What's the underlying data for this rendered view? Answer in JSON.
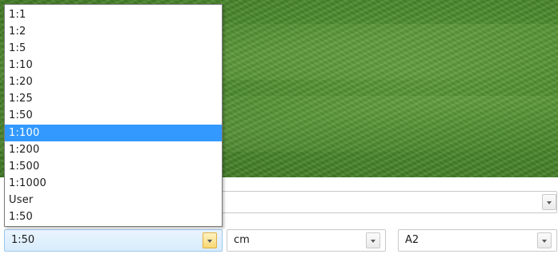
{
  "scale_dropdown": {
    "options": [
      "1:1",
      "1:2",
      "1:5",
      "1:10",
      "1:20",
      "1:25",
      "1:50",
      "1:100",
      "1:200",
      "1:500",
      "1:1000",
      "User",
      "1:50"
    ],
    "highlighted_index": 7
  },
  "toolbar": {
    "scale_value": "1:50",
    "unit_value": "cm",
    "paper_value": "A2",
    "preview_value": ""
  },
  "icons": [
    "chevron-down-icon"
  ],
  "colors": {
    "selection": "#3399ff",
    "active_combo": "#d8ecfc",
    "active_button": "#f8d873"
  }
}
